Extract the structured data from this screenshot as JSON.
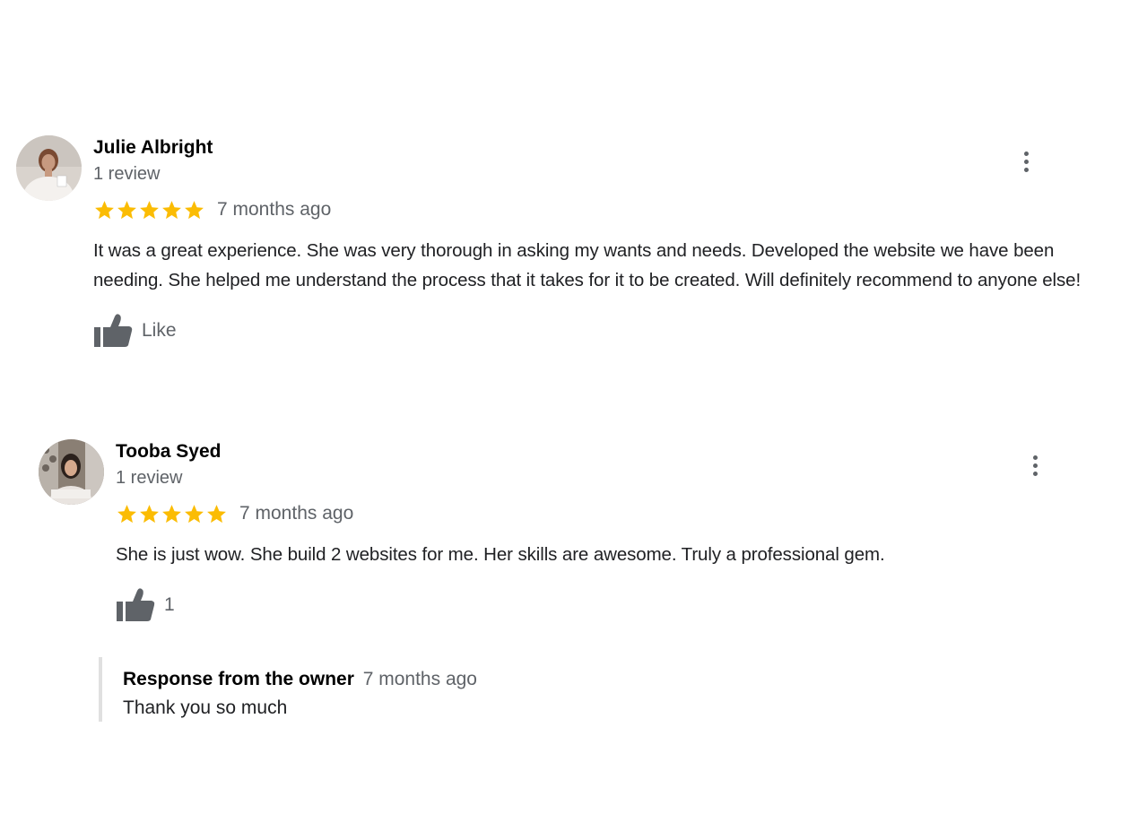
{
  "reviews": [
    {
      "reviewer_name": "Julie Albright",
      "review_count": "1 review",
      "rating": 5,
      "time": "7 months ago",
      "text": "It was a great experience. She was very thorough in asking my wants and needs. Developed the website we have been needing. She helped me understand the process that it takes for it to be created. Will definitely recommend to anyone else!",
      "like_label": "Like",
      "menu_icon": "more-vert-icon"
    },
    {
      "reviewer_name": "Tooba Syed",
      "review_count": "1 review",
      "rating": 5,
      "time": "7 months ago",
      "text": "She is just wow. She build 2 websites for me. Her skills are awesome. Truly a professional gem.",
      "like_label": "1",
      "menu_icon": "more-vert-icon",
      "owner_response": {
        "label": "Response from the owner",
        "time": "7 months ago",
        "text": "Thank you so much"
      }
    }
  ],
  "colors": {
    "star": "#FBBC04",
    "secondary_text": "#5f6368",
    "icon": "#5f6368",
    "response_border": "#e0e0e0"
  }
}
